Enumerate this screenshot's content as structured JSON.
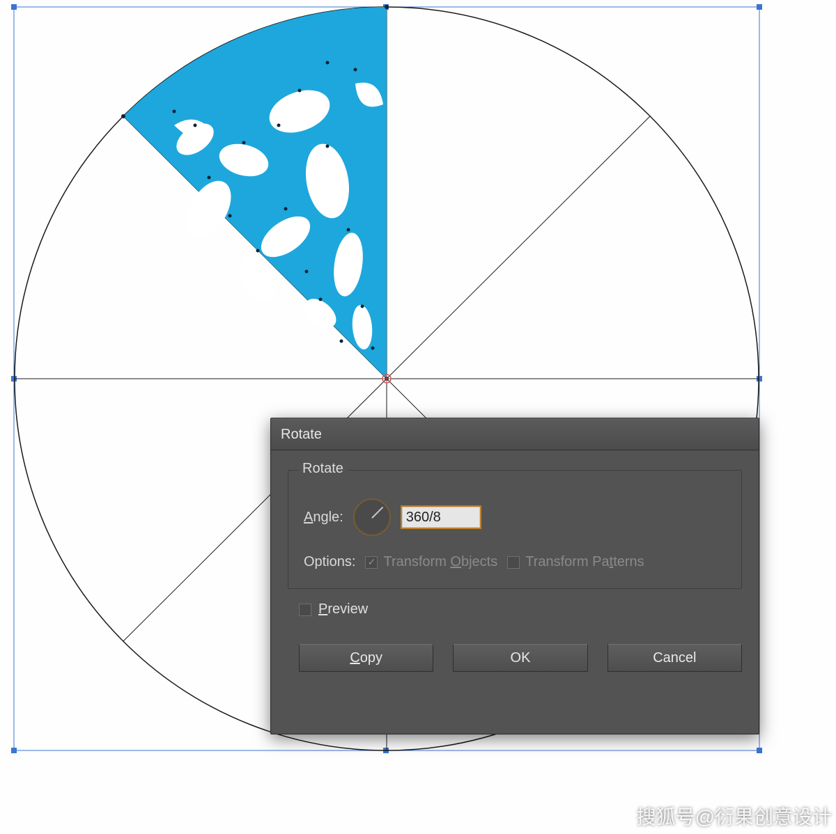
{
  "dialog": {
    "title": "Rotate",
    "panel_legend": "Rotate",
    "angle_label_prefix": "",
    "angle_label_u": "A",
    "angle_label_rest": "ngle:",
    "angle_value": "360/8",
    "options_label": "Options:",
    "transform_objects_prefix": "Transform ",
    "transform_objects_u": "O",
    "transform_objects_rest": "bjects",
    "transform_objects_checked": true,
    "transform_patterns_prefix": "Transform Pa",
    "transform_patterns_u": "t",
    "transform_patterns_rest": "terns",
    "transform_patterns_checked": false,
    "preview_u": "P",
    "preview_rest": "review",
    "preview_checked": false,
    "buttons": {
      "copy_u": "C",
      "copy_rest": "opy",
      "ok": "OK",
      "cancel": "Cancel"
    }
  },
  "colors": {
    "artwork_fill": "#1ea7dc",
    "selection": "#3b74d2",
    "guide": "#636363"
  },
  "watermark": "搜狐号@衍果创意设计"
}
